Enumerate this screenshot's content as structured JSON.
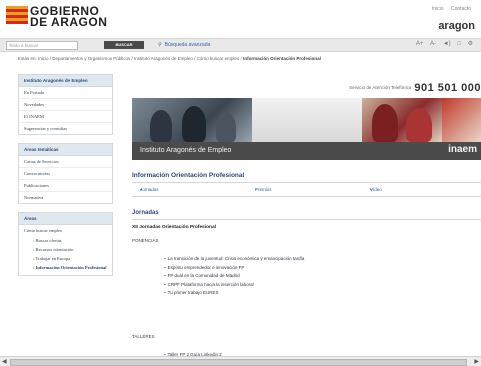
{
  "header": {
    "logo_line1": "GOBIERNO",
    "logo_line2": "DE ARAGON",
    "top_links": [
      "Inicio",
      "Contacto"
    ],
    "aragon": "aragon"
  },
  "search": {
    "placeholder": "Texto a buscar",
    "button": "BUSCAR",
    "advanced": "Búsqueda avanzada",
    "tools": [
      "A+",
      "A-",
      "◄)",
      "□",
      "⚙"
    ]
  },
  "breadcrumb": {
    "path": "Estás en: Inicio / Departamentos y Organismos Públicos / Instituto Aragonés de Empleo / Cómo buscar empleo /",
    "current": "Información Orientación Profesional"
  },
  "sidebar": {
    "panel1": {
      "title": "Instituto Aragonés de Empleo",
      "items": [
        "En Portada",
        "Novedades",
        "El INAEM",
        "Sugerencias y consultas"
      ]
    },
    "panel2": {
      "title": "Áreas temáticas",
      "items": [
        "Cartas de Servicios",
        "Convocatorias",
        "Publicaciones",
        "Normativa"
      ]
    },
    "panel3": {
      "title": "Áreas",
      "items": [
        "Cómo buscar empleo"
      ],
      "subitems": [
        "Buscar ofertas",
        "Recursos orientación",
        "Trabajar en Europa",
        "Información Orientación Profesional"
      ]
    }
  },
  "main": {
    "phone_label": "Servicio de Atención Telefónica",
    "phone_number": "901 501 000",
    "banner_title": "Instituto Aragonés de Empleo",
    "banner_logo": "inaem",
    "section_title": "Información Orientación Profesional",
    "subnav": [
      "Jornadas",
      "Premios",
      "Vídeo"
    ],
    "jornadas_heading": "Jornadas",
    "xii_heading": "XII Jornadas Orientación Profesional",
    "ponencias_label": "PONENCIAS",
    "ponencias": [
      "La transición de la juventud: Crisis económica y emancipación tardía",
      "Espíritu emprendedor e innovación FP",
      "FP dual en la Comunidad de Madrid",
      "CRPF Plataforma hacia la inserción laboral",
      "Tu primer trabajo EURES"
    ],
    "talleres_label": "TALLERES",
    "talleres_item": "Taller FP 2 Guía Linkedin 2"
  }
}
